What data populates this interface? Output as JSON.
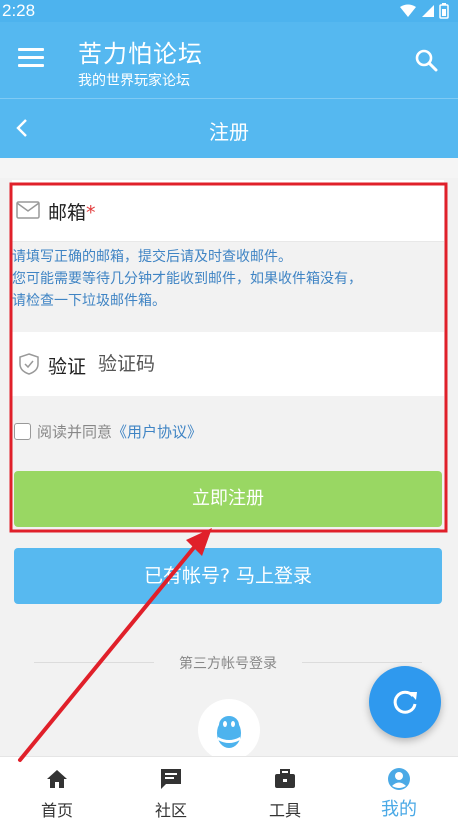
{
  "status": {
    "time": "2:28"
  },
  "header": {
    "title": "苦力怕论坛",
    "subtitle": "我的世界玩家论坛"
  },
  "subheader": {
    "title": "注册"
  },
  "form": {
    "email_label": "邮箱",
    "required_mark": "*",
    "hint_lines": [
      "请填写正确的邮箱，提交后请及时查收邮件。",
      "您可能需要等待几分钟才能收到邮件，如果收件箱没有，",
      "请检查一下垃圾邮件箱。"
    ],
    "verify_label": "验证",
    "verify_placeholder": "验证码",
    "agree_text": "阅读并同意",
    "agree_link": "《用户协议》",
    "register_button": "立即注册",
    "login_button": "已有帐号? 马上登录",
    "third_party_label": "第三方帐号登录"
  },
  "tabs": [
    {
      "label": "首页",
      "icon": "home-icon"
    },
    {
      "label": "社区",
      "icon": "chat-icon"
    },
    {
      "label": "工具",
      "icon": "briefcase-icon"
    },
    {
      "label": "我的",
      "icon": "person-icon",
      "active": true
    }
  ],
  "colors": {
    "primary": "#55b8f0",
    "register_button": "#99d763",
    "fab": "#2f99ee",
    "annotation": "#e0202a"
  }
}
